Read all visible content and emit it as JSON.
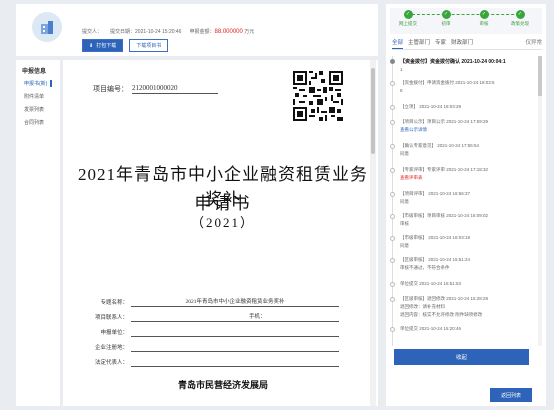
{
  "header": {
    "submitter_label": "提交人：",
    "submit_date_label": "提交日期：",
    "submit_date": "2021-10-24 15:20:46",
    "apply_amount_label": "申报金额：",
    "apply_amount": "88.000000",
    "apply_amount_unit": "万元",
    "print_label": "打包下载",
    "download_label": "下载项目书"
  },
  "nav": {
    "title": "申报信息",
    "items": [
      "申报书(新)",
      "附件清单",
      "发票列表",
      "合同列表"
    ]
  },
  "document": {
    "project_no_label": "项目编号：",
    "project_no": "2120001000020",
    "title_line1": "2021年青岛市中小企业融资租赁业务奖补",
    "title_line2": "申请书",
    "title_line3": "（2021）",
    "form": [
      {
        "label": "专题名称：",
        "value": "2021年青岛市中小企业融资租赁业务奖补"
      },
      {
        "label": "项目联系人：",
        "value": "",
        "extra": "手机："
      },
      {
        "label": "申报单位：",
        "value": ""
      },
      {
        "label": "企业注册地：",
        "value": ""
      },
      {
        "label": "法定代表人：",
        "value": ""
      }
    ],
    "organization": "青岛市民营经济发展局"
  },
  "progress": {
    "steps": [
      "网上提交",
      "初审",
      "审核",
      "政策兑现"
    ]
  },
  "tabs": [
    "全部",
    "主管部门",
    "专家",
    "财政部门",
    "仅异常"
  ],
  "timeline": [
    {
      "title": "【资金拨付】资金拨付确认",
      "time": "2021-10-24 00:04:1",
      "sub": "1",
      "bold": true
    },
    {
      "title": "【资金拨付】申请资金拨付",
      "time": "2021-10-24 18:03:5",
      "sub": "8"
    },
    {
      "title": "【立项】",
      "time": "2021-10-24 18:03:29",
      "sub": ""
    },
    {
      "title": "【项目公示】项目公示",
      "time": "2021-10-24 17:59:29",
      "sub": "查看公示详情",
      "sublink": true
    },
    {
      "title": "【确认专家意见】",
      "time": "2021-10-24 17:55:54",
      "sub": "同意"
    },
    {
      "title": "【专家评审】专家评审",
      "time": "2021-10-24 17:18:32",
      "sub": "查看评审表",
      "subred": true
    },
    {
      "title": "【项目评审】",
      "time": "2021-10-24 16:56:37",
      "sub": "同意"
    },
    {
      "title": "【市级审核】项目审核",
      "time": "2021-10-24 16:09:02",
      "sub": "审核"
    },
    {
      "title": "【市级审核】",
      "time": "2021-10-24 16:03:19",
      "sub": "同意"
    },
    {
      "title": "【区级审核】",
      "time": "2021-10-24 15:51:24",
      "sub": "审核不通过，不符合条件"
    },
    {
      "title": "单位提交",
      "time": "2021-10-24 15:51:53",
      "sub": ""
    },
    {
      "title": "【区级审核】退回修改",
      "time": "2021-10-24 15:28:28",
      "sub": "退回修改：请补充材料",
      "sub2": "退回内容：核实不允许修改 附件缺项修改"
    },
    {
      "title": "单位提交",
      "time": "2021-10-24 15:20:46",
      "sub": ""
    }
  ],
  "back_label": "收起",
  "bottom_button": "返回列表"
}
